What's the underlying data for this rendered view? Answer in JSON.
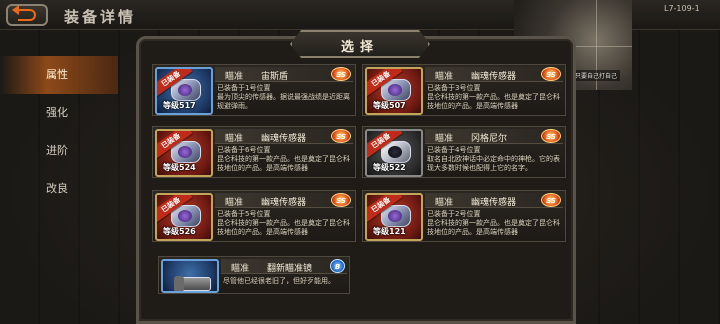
{
  "page_title": "装备详情",
  "sidebar": {
    "items": [
      {
        "label": "属性",
        "active": true
      },
      {
        "label": "强化",
        "active": false
      },
      {
        "label": "进阶",
        "active": false
      },
      {
        "label": "改良",
        "active": false
      }
    ]
  },
  "minimap": {
    "caption": "所以只要自己打自己"
  },
  "level_code": "L7-109-1",
  "panel": {
    "title": "选择"
  },
  "cards": [
    {
      "category": "瞄准",
      "name": "宙斯盾",
      "equipped_label": "已装备",
      "level": "等级517",
      "rarity": "SS",
      "desc": "已装备于1号位置\n最为顶尖的传感器。据说最强战绩是近距离规避弹雨。"
    },
    {
      "category": "瞄准",
      "name": "幽魂传感器",
      "equipped_label": "已装备",
      "level": "等级507",
      "rarity": "SS",
      "desc": "已装备于3号位置\n昆仑科技的第一款产品。也是奠定了昆仑科技地位的产品。是高端传感器"
    },
    {
      "category": "瞄准",
      "name": "幽魂传感器",
      "equipped_label": "已装备",
      "level": "等级524",
      "rarity": "SS",
      "desc": "已装备于6号位置\n昆仑科技的第一款产品。也是奠定了昆仑科技地位的产品。是高端传感器"
    },
    {
      "category": "瞄准",
      "name": "冈格尼尔",
      "equipped_label": "已装备",
      "level": "等级522",
      "rarity": "SS",
      "desc": "已装备于4号位置\n取名自北欧神话中必定命中的神枪。它的表现大多数时候也配得上它的名字。"
    },
    {
      "category": "瞄准",
      "name": "幽魂传感器",
      "equipped_label": "已装备",
      "level": "等级526",
      "rarity": "SS",
      "desc": "已装备于5号位置\n昆仑科技的第一款产品。也是奠定了昆仑科技地位的产品。是高端传感器"
    },
    {
      "category": "瞄准",
      "name": "幽魂传感器",
      "equipped_label": "已装备",
      "level": "等级121",
      "rarity": "SS",
      "desc": "已装备于2号位置\n昆仑科技的第一款产品。也是奠定了昆仑科技地位的产品。是高端传感器"
    },
    {
      "category": "瞄准",
      "name": "翻新瞄准镜",
      "equipped_label": "",
      "level": "",
      "rarity": "B",
      "desc": "尽管他已经很老旧了，但好歹能用。"
    }
  ],
  "colors": {
    "accent": "#e86a1a",
    "equipped": "#c02a18",
    "ss_badge": "#e4571c",
    "b_badge": "#2a6ed0"
  }
}
